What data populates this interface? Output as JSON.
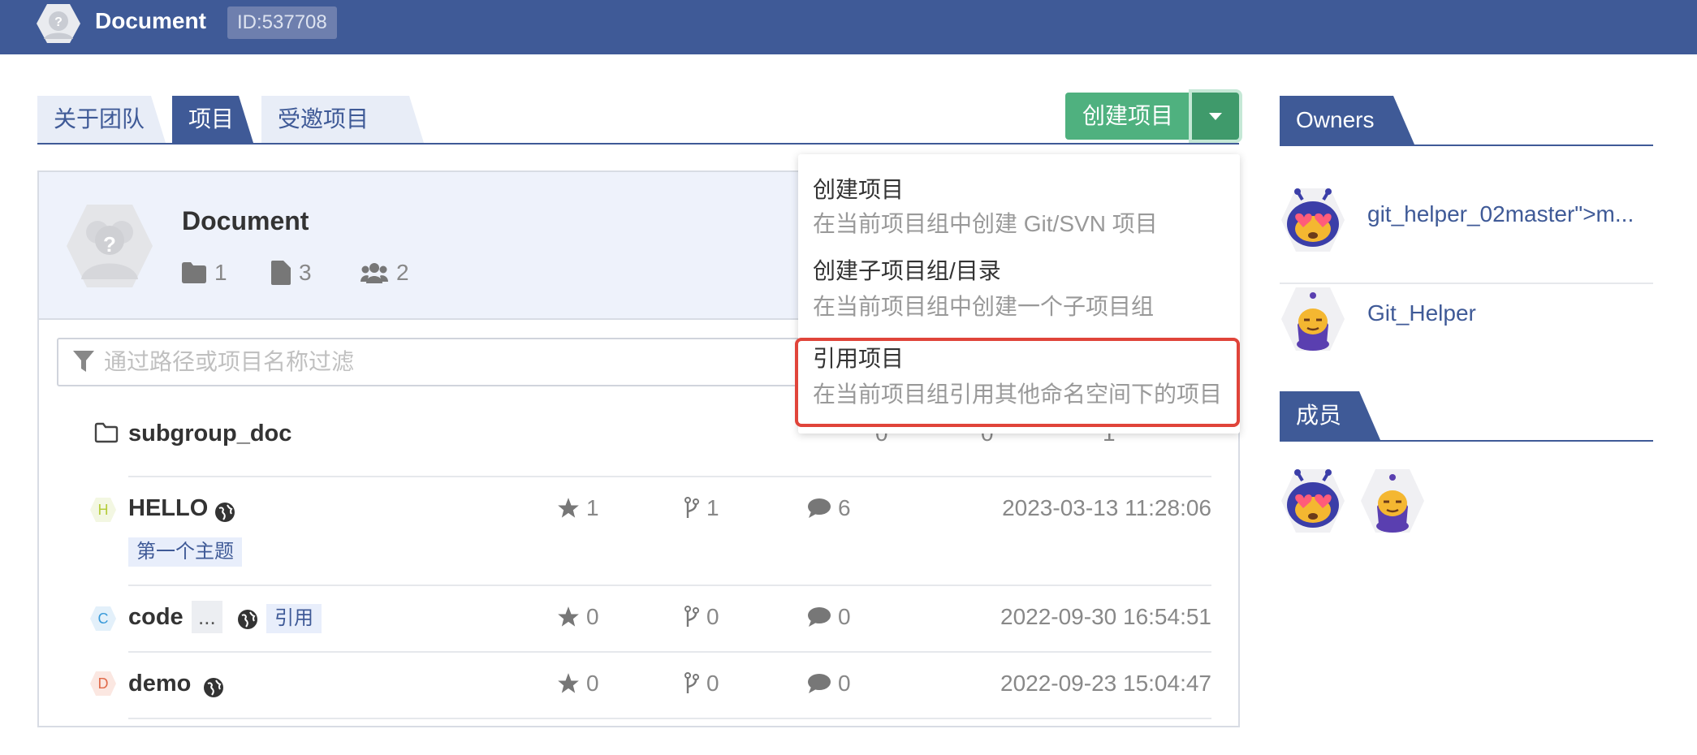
{
  "header": {
    "title": "Document",
    "id_badge": "ID:537708"
  },
  "tabs": [
    {
      "label": "关于团队",
      "active": false
    },
    {
      "label": "项目",
      "active": true
    },
    {
      "label": "受邀项目",
      "active": false
    }
  ],
  "create_button": {
    "label": "创建项目"
  },
  "group": {
    "name": "Document",
    "stats": {
      "folders": "1",
      "files": "3",
      "members": "2"
    }
  },
  "filter": {
    "placeholder": "通过路径或项目名称过滤"
  },
  "subgroup": {
    "name": "subgroup_doc",
    "folders": "0",
    "files": "0",
    "members": "1"
  },
  "projects": [
    {
      "initial": "H",
      "name": "HELLO",
      "stars": "1",
      "forks": "1",
      "comments": "6",
      "date": "2023-03-13 11:28:06",
      "topic": "第一个主题",
      "color": "#b5cc3a"
    },
    {
      "initial": "C",
      "name": "code",
      "ellipsis": "...",
      "ref_tag": "引用",
      "stars": "0",
      "forks": "0",
      "comments": "0",
      "date": "2022-09-30 16:54:51",
      "color": "#3a9ad9"
    },
    {
      "initial": "D",
      "name": "demo",
      "stars": "0",
      "forks": "0",
      "comments": "0",
      "date": "2022-09-23 15:04:47",
      "color": "#e06a4a"
    }
  ],
  "dropdown": {
    "items": [
      {
        "title": "创建项目",
        "desc": "在当前项目组中创建 Git/SVN 项目"
      },
      {
        "title": "创建子项目组/目录",
        "desc": "在当前项目组中创建一个子项目组"
      },
      {
        "title": "引用项目",
        "desc": "在当前项目组引用其他命名空间下的项目"
      }
    ]
  },
  "sidebar": {
    "owners_title": "Owners",
    "owners": [
      {
        "name": "git_helper_02master\">m..."
      },
      {
        "name": "Git_Helper"
      }
    ],
    "members_title": "成员"
  }
}
